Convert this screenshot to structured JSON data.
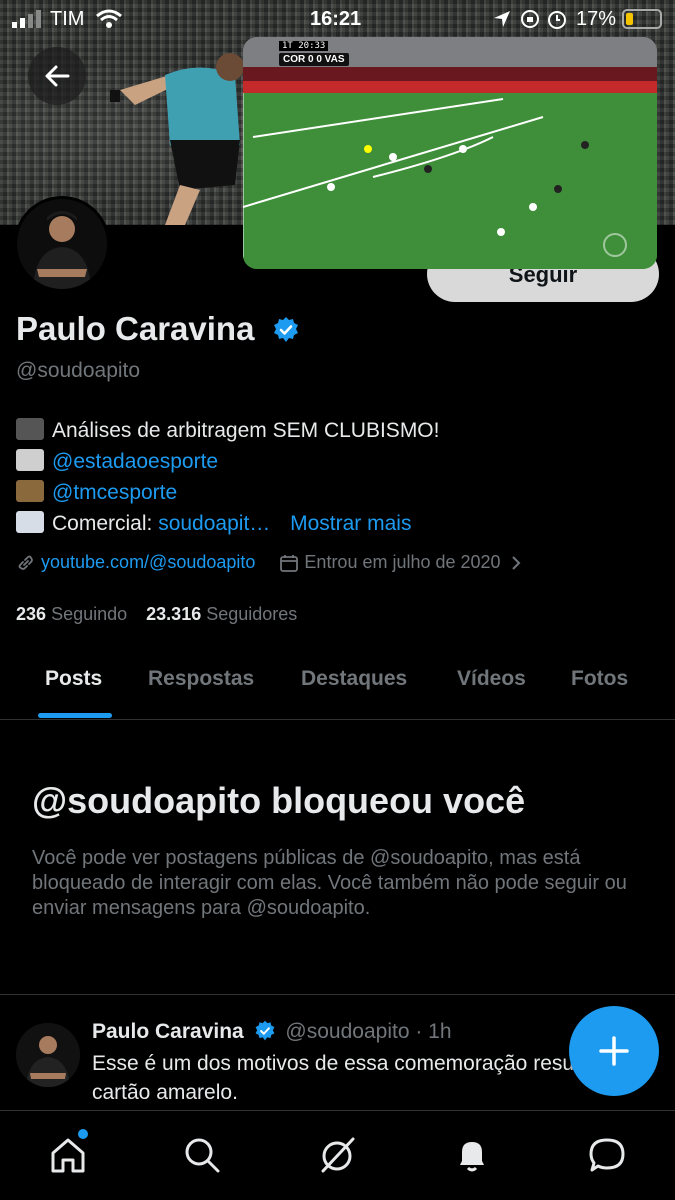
{
  "status_bar": {
    "carrier": "TIM",
    "time": "16:21",
    "battery": "17%"
  },
  "pip_video": {
    "score_text": "COR 0 0 VAS",
    "match_time": "1T 20:33"
  },
  "profile": {
    "name": "Paulo Caravina",
    "handle": "@soudoapito",
    "follow_button": "Seguir",
    "bio": {
      "line1": "Análises de arbitragem SEM CLUBISMO!",
      "line2_link": "@estadaoesporte",
      "line3_link": "@tmcesporte",
      "line4_prefix": "Comercial:",
      "line4_link": "soudoapit…",
      "show_more": "Mostrar mais"
    },
    "website": "youtube.com/@soudoapito",
    "joined": "Entrou em julho de 2020",
    "following_count": "236",
    "following_label": "Seguindo",
    "followers_count": "23.316",
    "followers_label": "Seguidores"
  },
  "tabs": [
    "Posts",
    "Respostas",
    "Destaques",
    "Vídeos",
    "Fotos"
  ],
  "blocked": {
    "title": "@soudoapito bloqueou você",
    "description": "Você pode ver postagens públicas de @soudoapito, mas está bloqueado de interagir com elas. Você também não pode seguir ou enviar mensagens para @soudoapito."
  },
  "post": {
    "author": "Paulo Caravina",
    "handle_time": "@soudoapito · 1h",
    "text": "Esse é um dos motivos de essa comemoração resultar em cartão amarelo."
  },
  "colors": {
    "accent": "#1d9bf0",
    "background": "#000000",
    "secondary_text": "#71767b"
  }
}
